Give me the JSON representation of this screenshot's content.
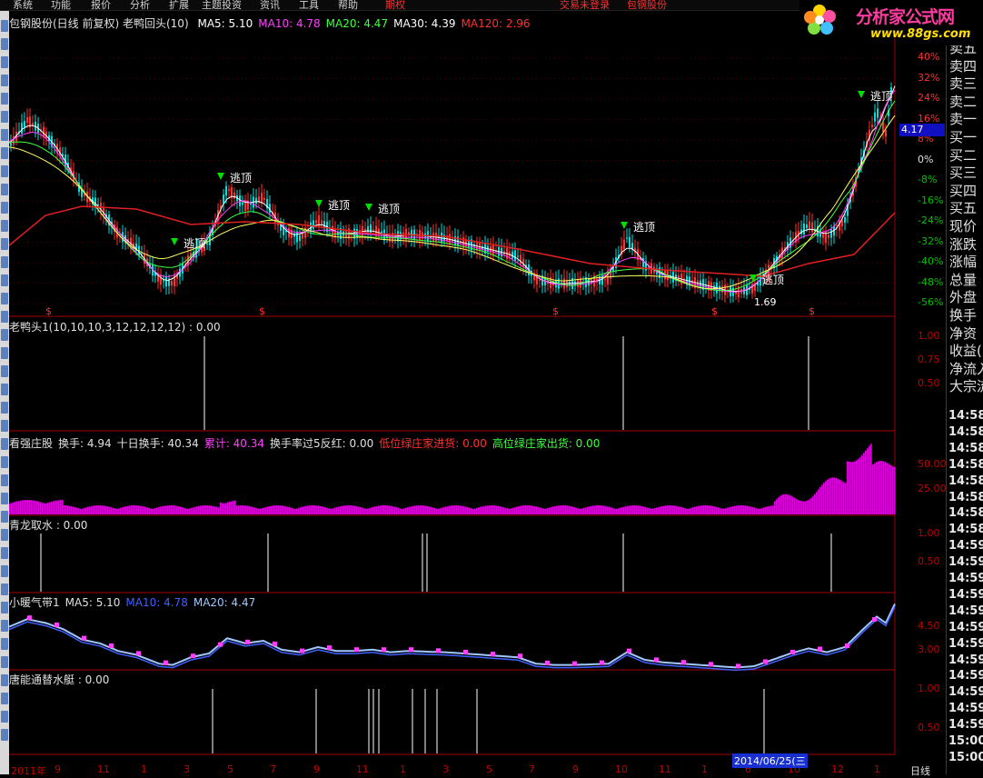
{
  "menu": {
    "items": [
      "系统",
      "功能",
      "报价",
      "分析",
      "扩展",
      "主题投资",
      "资讯",
      "工具",
      "帮助"
    ],
    "special": "期权",
    "status": "交易未登录",
    "stock": "包钢股份"
  },
  "logo": {
    "text": "分析家公式网",
    "url": "www.88gs.com"
  },
  "main": {
    "title": "包钢股份(日线 前复权) 老鸭回头(10)",
    "ma": [
      {
        "label": "MA5: 5.10",
        "color": "#ffffff"
      },
      {
        "label": "MA10: 4.78",
        "color": "#ff40ff"
      },
      {
        "label": "MA20: 4.47",
        "color": "#40ff40"
      },
      {
        "label": "MA30: 4.39",
        "color": "#ffffff"
      },
      {
        "label": "MA120: 2.96",
        "color": "#ff3030"
      }
    ],
    "pct_ticks": [
      "40%",
      "32%",
      "24%",
      "16%",
      "8%",
      "0%",
      "-8%",
      "-16%",
      "-24%",
      "-32%",
      "-40%",
      "-48%",
      "-56%"
    ],
    "annotations": [
      "逃顶",
      "逃顶",
      "逃顶",
      "逃顶",
      "逃顶",
      "逃顶",
      "逃顶"
    ],
    "low_label": "1.69",
    "last_price": "4.17",
    "marker_glyph": "$"
  },
  "panels": {
    "laoya": {
      "title": "老鸭头1(10,10,10,3,12,12,12,12) : 0.00",
      "ticks": [
        "1.00",
        "0.75",
        "0.50"
      ]
    },
    "zhuang": {
      "labels": [
        {
          "text": "看强庄股",
          "color": "#e0e0e0"
        },
        {
          "text": "换手: 4.94",
          "color": "#e0e0e0"
        },
        {
          "text": "十日换手: 40.34",
          "color": "#e0e0e0"
        },
        {
          "text": "累计: 40.34",
          "color": "#ff40ff"
        },
        {
          "text": "换手率过5反红: 0.00",
          "color": "#e0e0e0"
        },
        {
          "text": "低位绿庄家进货: 0.00",
          "color": "#ff3030"
        },
        {
          "text": "高位绿庄家出货: 0.00",
          "color": "#40ff40"
        }
      ],
      "ticks": [
        "50.00",
        "25.00"
      ]
    },
    "qinglong": {
      "title": "青龙取水 : 0.00",
      "ticks": [
        "1.00",
        "0.50"
      ]
    },
    "nuanqi": {
      "labels": [
        {
          "text": "小暖气带1",
          "color": "#e0e0e0"
        },
        {
          "text": "MA5: 5.10",
          "color": "#e0e0e0"
        },
        {
          "text": "MA10: 4.78",
          "color": "#4060ff"
        },
        {
          "text": "MA20: 4.47",
          "color": "#a0c8ff"
        }
      ],
      "ticks": [
        "4.50",
        "3.00"
      ]
    },
    "tangneng": {
      "title": "唐能通替水艇 : 0.00",
      "ticks": [
        "1.00",
        "0.50"
      ]
    }
  },
  "x_axis": {
    "labels": [
      "2011年",
      "9",
      "11",
      "1",
      "3",
      "5",
      "7",
      "9",
      "11",
      "1",
      "3",
      "5",
      "7",
      "9",
      "10",
      "11",
      "1",
      "6",
      "10",
      "12",
      "1"
    ],
    "date_badge": "2014/06/25(三",
    "period": "日线"
  },
  "right_panel": {
    "quote_rows": [
      "卖五",
      "卖四",
      "卖三",
      "卖二",
      "卖一",
      "买一",
      "买二",
      "买三",
      "买四",
      "买五",
      "现价",
      "涨跌",
      "涨幅",
      "总量",
      "外盘",
      "换手",
      "净资",
      "收益(5",
      "净流入",
      "大宗流"
    ],
    "times": [
      "14:58",
      "14:58",
      "14:58",
      "14:58",
      "14:58",
      "14:58",
      "14:58",
      "14:58",
      "14:59",
      "14:59",
      "14:59",
      "14:59",
      "14:59",
      "14:59",
      "14:59",
      "14:59",
      "14:59",
      "14:59",
      "14:59",
      "14:59",
      "15:00",
      "15:00"
    ]
  }
}
